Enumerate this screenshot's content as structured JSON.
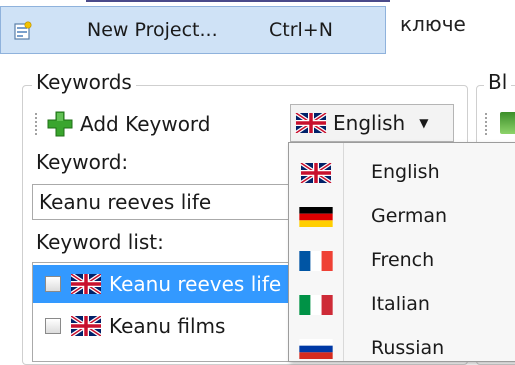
{
  "menu": {
    "new_project": {
      "label": "New Project...",
      "shortcut": "Ctrl+N",
      "icon": "new-project-icon"
    },
    "background_text": "ключе"
  },
  "keywords_group": {
    "legend": "Keywords",
    "toolbar": {
      "add_label": "Add Keyword"
    },
    "language_select": {
      "selected": "English"
    },
    "keyword_label": "Keyword:",
    "keyword_value": "Keanu reeves life",
    "keyword_list_label": "Keyword list:",
    "keyword_list": [
      {
        "text": "Keanu reeves life",
        "flag": "uk-flag",
        "selected": true,
        "checked": false
      },
      {
        "text": "Keanu films",
        "flag": "uk-flag",
        "selected": false,
        "checked": false
      }
    ]
  },
  "second_group": {
    "legend": "Bl"
  },
  "language_dropdown": {
    "options": [
      {
        "label": "English",
        "flag": "uk-flag"
      },
      {
        "label": "German",
        "flag": "germany-flag"
      },
      {
        "label": "French",
        "flag": "france-flag"
      },
      {
        "label": "Italian",
        "flag": "italy-flag"
      },
      {
        "label": "Russian",
        "flag": "russia-flag"
      }
    ]
  },
  "colors": {
    "selection": "#3399ff",
    "menu_highlight": "#cfe2f6",
    "add_icon": "#3aa52e"
  }
}
